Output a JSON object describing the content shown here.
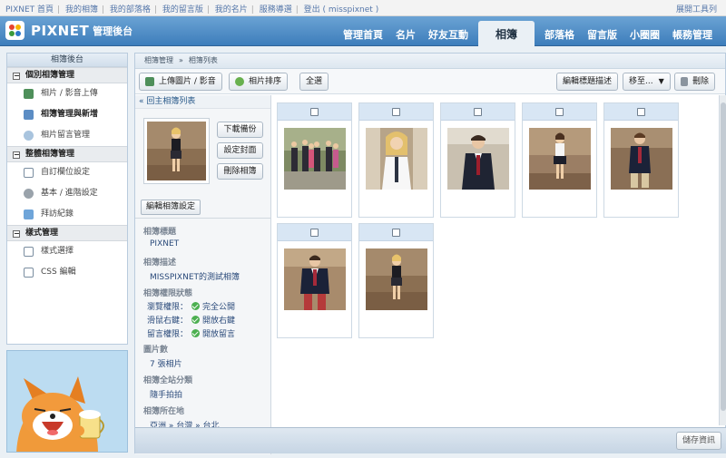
{
  "topbar": {
    "links": [
      "PIXNET 首頁",
      "我的相簿",
      "我的部落格",
      "我的留言版",
      "我的名片",
      "服務導選",
      "登出 ( misspixnet )"
    ],
    "tools": "展開工具列"
  },
  "header": {
    "logo": "PIXNET",
    "subtitle": "管理後台",
    "tabs": [
      "管理首頁",
      "名片",
      "好友互動",
      "相簿",
      "部落格",
      "留言版",
      "小圈圈",
      "帳務管理"
    ],
    "active_tab": "相簿"
  },
  "sidebar": {
    "title": "相簿後台",
    "sections": [
      {
        "title": "個別相簿管理",
        "items": [
          {
            "label": "相片 / 影音上傳",
            "icon": "upload-icon",
            "bold": false
          },
          {
            "label": "相簿管理與新增",
            "icon": "album-icon",
            "bold": true
          },
          {
            "label": "相片留言管理",
            "icon": "comment-icon",
            "bold": false
          }
        ]
      },
      {
        "title": "整體相簿管理",
        "items": [
          {
            "label": "自訂欄位設定",
            "icon": "field-icon",
            "bold": false
          },
          {
            "label": "基本 / 進階設定",
            "icon": "gear-icon",
            "bold": false
          },
          {
            "label": "拜訪紀錄",
            "icon": "visitor-icon",
            "bold": false
          }
        ]
      },
      {
        "title": "樣式管理",
        "items": [
          {
            "label": "樣式選擇",
            "icon": "style-icon",
            "bold": false
          },
          {
            "label": "CSS 編輯",
            "icon": "css-icon",
            "bold": false
          }
        ]
      }
    ]
  },
  "breadcrumb": [
    "相簿管理",
    "»",
    "相簿列表"
  ],
  "toolbar": {
    "upload": "上傳圖片 / 影音",
    "sort": "相片排序",
    "select_all": "全選",
    "edit_desc": "編輯標題描述",
    "move": "移至...",
    "delete": "刪除"
  },
  "album_panel": {
    "back": "« 回主相簿列表",
    "download": "下載備份",
    "set_cover": "設定封面",
    "delete_album": "刪除相簿",
    "edit_settings": "編輯相簿設定",
    "title_label": "相簿標題",
    "title_value": "PIXNET",
    "desc_label": "相簿描述",
    "desc_value": "MISSPIXNET的測試相簿",
    "perm_label": "相簿權限狀態",
    "perms": [
      {
        "label": "瀏覽權限：",
        "value": "完全公開"
      },
      {
        "label": "滑鼠右鍵：",
        "value": "開放右鍵"
      },
      {
        "label": "留言權限：",
        "value": "開放留言"
      }
    ],
    "count_label": "圖片數",
    "count_value": "7 張相片",
    "category_label": "相簿全站分類",
    "category_value": "隨手拍拍",
    "location_label": "相簿所在地",
    "location_value": "亞洲 » 台灣 » 台北"
  },
  "photos_count": 7,
  "footer": {
    "save": "儲存資訊"
  },
  "colors": {
    "header": "#3d7dbb",
    "accent": "#2a5a8a",
    "card_top": "#d8e6f4"
  }
}
